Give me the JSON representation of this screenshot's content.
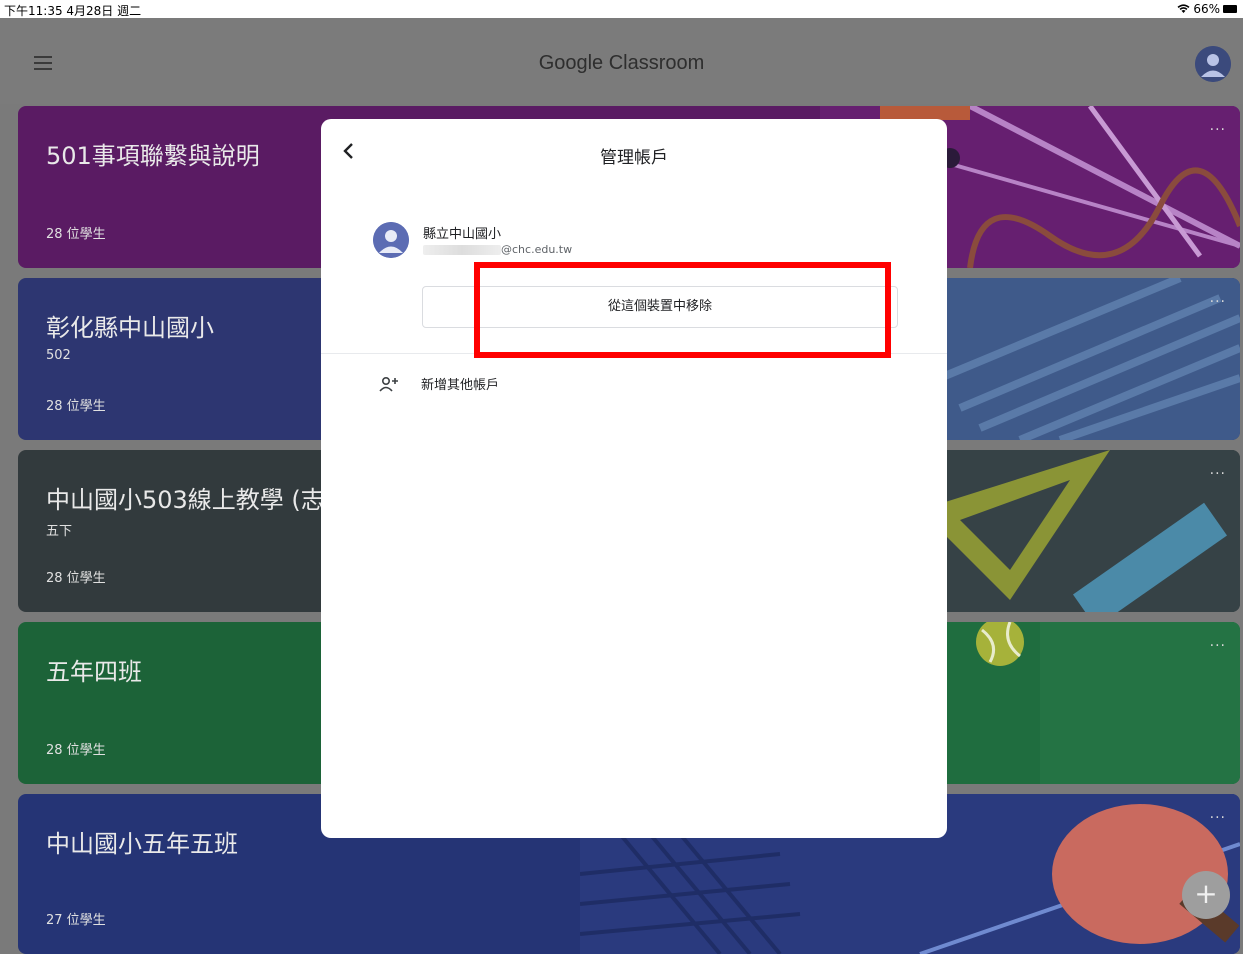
{
  "status_bar": {
    "time_date": "下午11:35  4月28日 週二",
    "battery": "66%",
    "wifi_icon": "wifi-icon"
  },
  "app_bar": {
    "title": "Google Classroom",
    "menu_icon": "menu-icon",
    "account_icon": "account-avatar-icon"
  },
  "classes": [
    {
      "name": "501事項聯繫與說明",
      "section": "",
      "students": "28 位學生",
      "color": "#6b1f73"
    },
    {
      "name": "彰化縣中山國小",
      "section": "502",
      "students": "28 位學生",
      "color": "#2f3a75"
    },
    {
      "name": "中山國小503線上教學 (志",
      "section": "五下",
      "students": "28 位學生",
      "color": "#364043"
    },
    {
      "name": "五年四班",
      "section": "",
      "students": "28 位學生",
      "color": "#1f6b3b"
    },
    {
      "name": "中山國小五年五班",
      "section": "",
      "students": "27 位學生",
      "color": "#283a7a"
    }
  ],
  "card_more": "···",
  "fab": {
    "label": "+"
  },
  "dialog": {
    "title": "管理帳戶",
    "account": {
      "name": "縣立中山國小",
      "email_suffix": "@chc.edu.tw"
    },
    "remove_button": "從這個裝置中移除",
    "add_account": "新增其他帳戶"
  }
}
